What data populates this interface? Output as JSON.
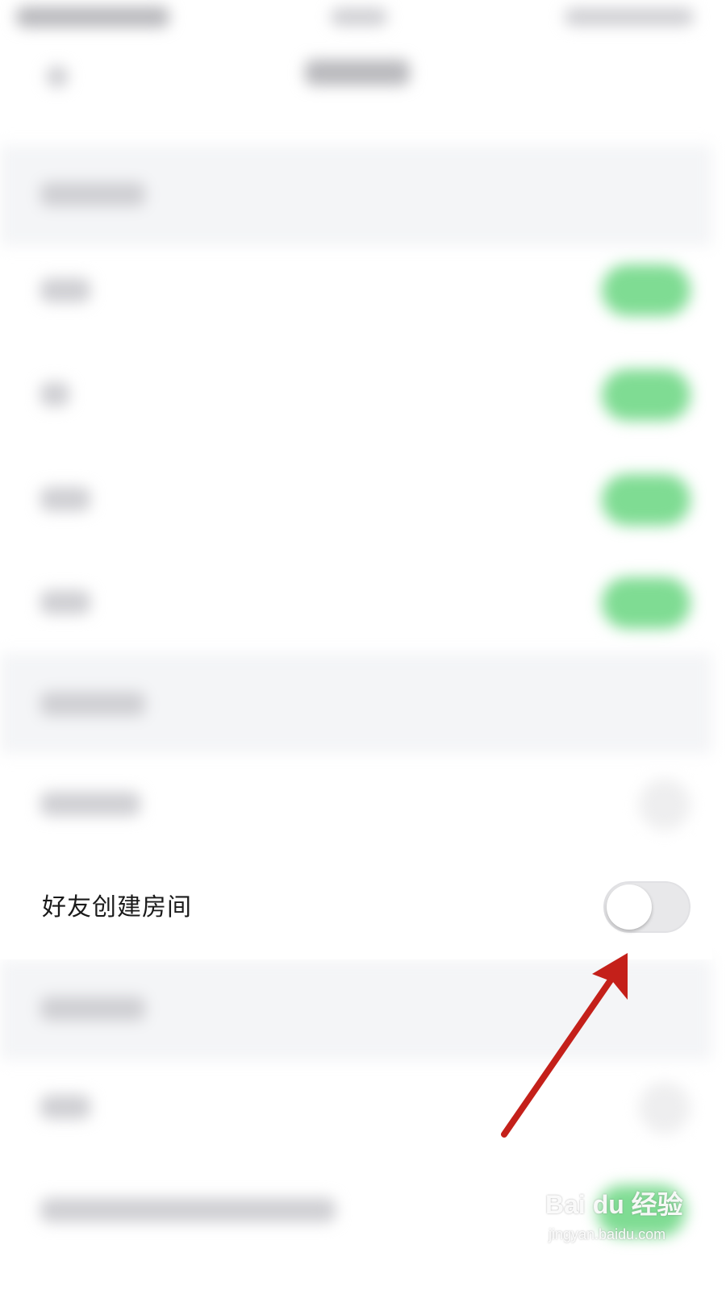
{
  "row": {
    "label": "好友创建房间",
    "toggle_on": false
  },
  "watermark": {
    "logo_text": "Bai du 经验",
    "sub_text": "jingyan.baidu.com"
  },
  "colors": {
    "toggle_off_track": "#e8e8ea",
    "toggle_on_track": "#7fdc93",
    "arrow": "#c4201a"
  }
}
